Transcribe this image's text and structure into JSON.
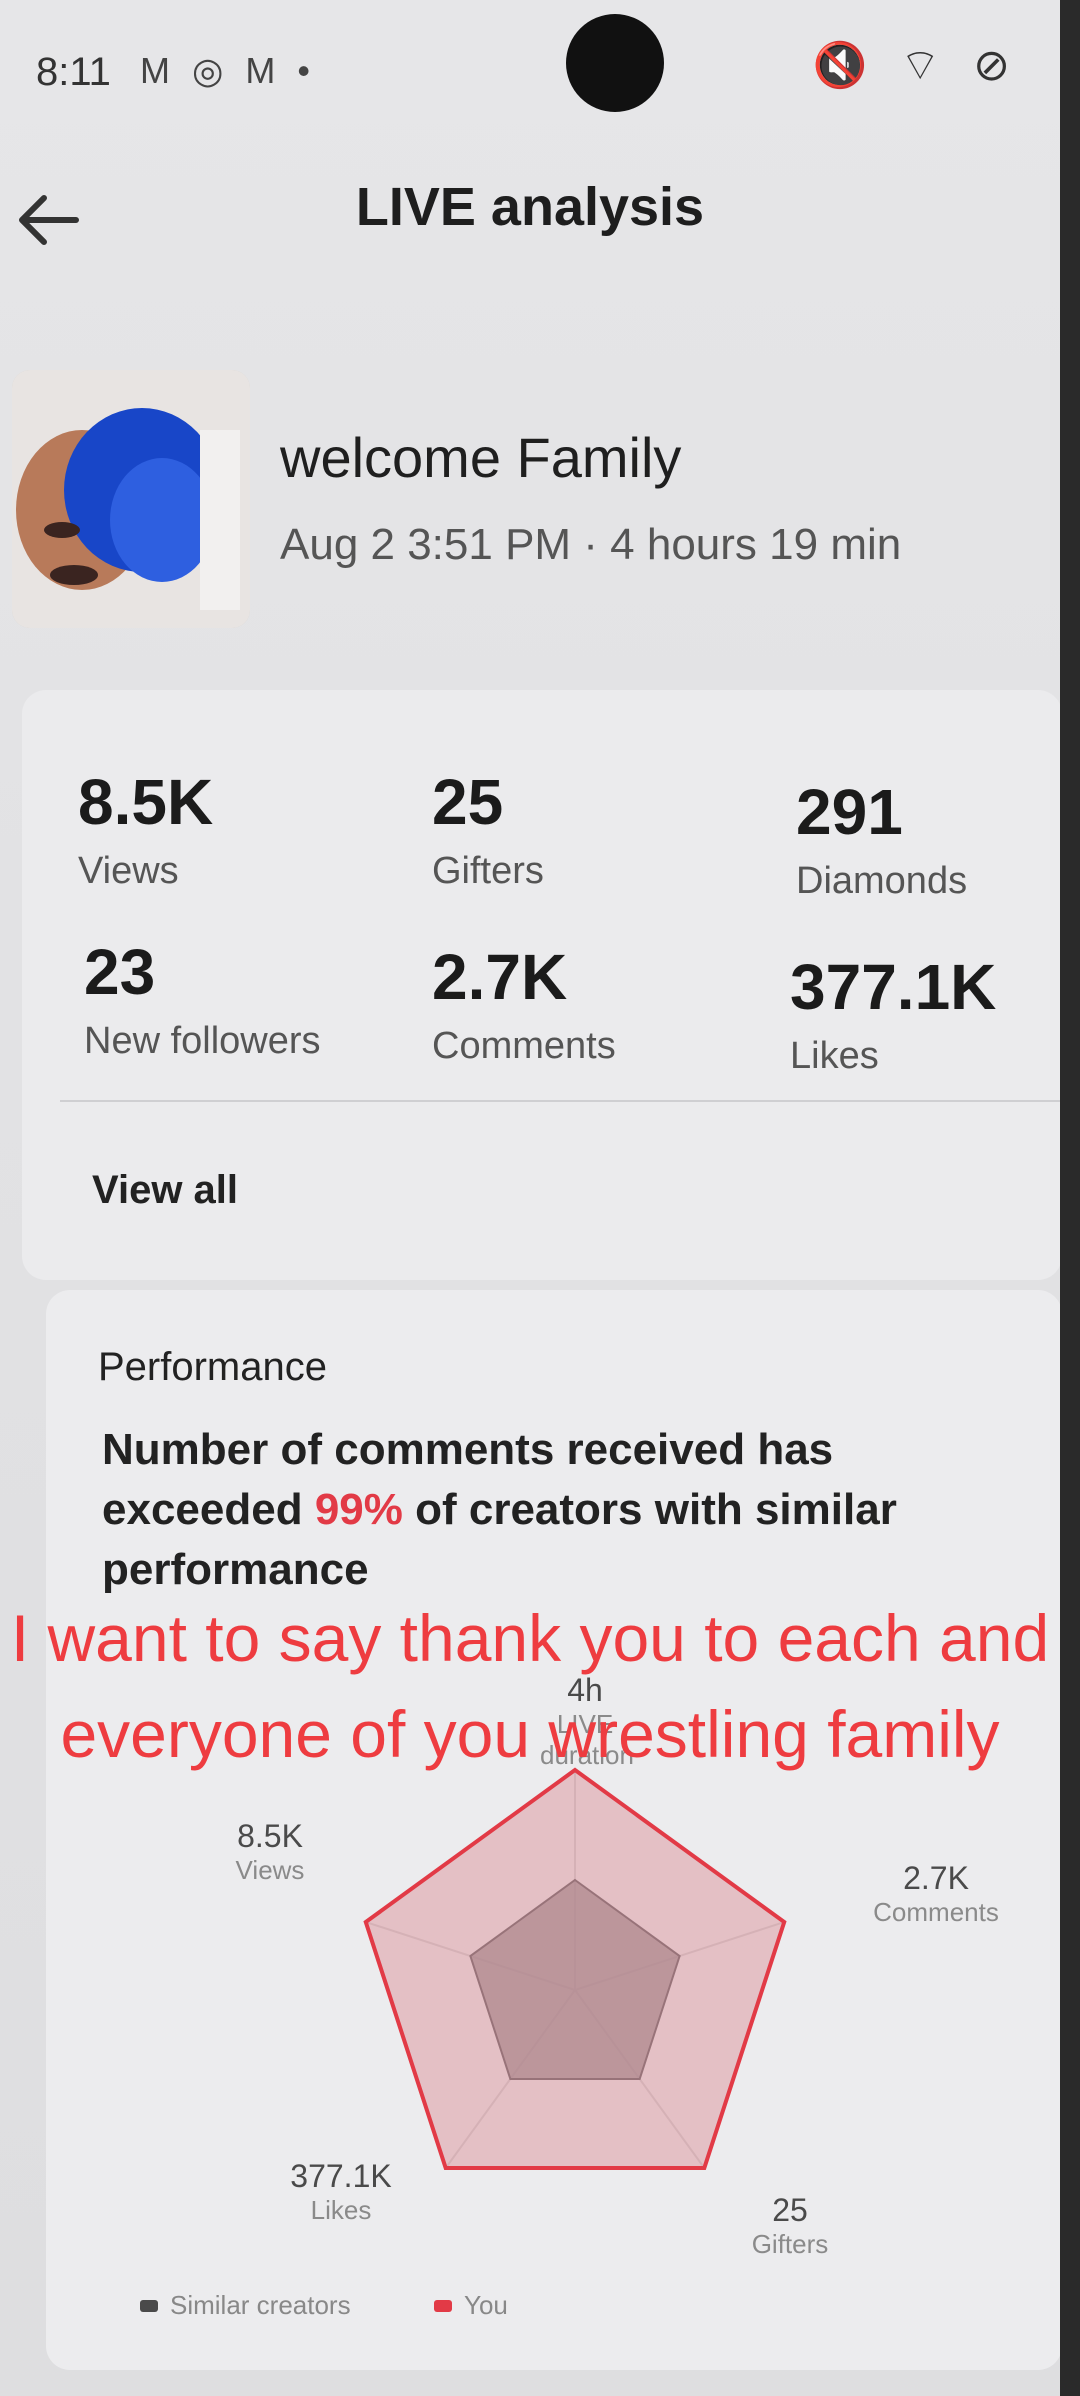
{
  "status_bar": {
    "time": "8:11",
    "notification_icons": "M ◎ M •",
    "right_icons": "🔇 ⌔ ⊘"
  },
  "header": {
    "title": "LIVE analysis"
  },
  "stream": {
    "title": "welcome Family",
    "meta": "Aug 2 3:51 PM · 4 hours 19 min"
  },
  "stats": [
    {
      "value": "8.5K",
      "label": "Views"
    },
    {
      "value": "25",
      "label": "Gifters"
    },
    {
      "value": "291",
      "label": "Diamonds"
    },
    {
      "value": "23",
      "label": "New followers"
    },
    {
      "value": "2.7K",
      "label": "Comments"
    },
    {
      "value": "377.1K",
      "label": "Likes"
    }
  ],
  "view_all_label": "View all",
  "performance": {
    "heading": "Performance",
    "text_before": "Number of comments received has exceeded ",
    "percent": "99%",
    "text_after": " of creators with similar performance"
  },
  "overlay_caption": "I want to say thank you to each and everyone of you wrestling family",
  "chart_data": {
    "type": "radar",
    "axes": [
      {
        "value": "4h",
        "label": "LIVE duration"
      },
      {
        "value": "2.7K",
        "label": "Comments"
      },
      {
        "value": "25",
        "label": "Gifters"
      },
      {
        "value": "377.1K",
        "label": "Likes"
      },
      {
        "value": "8.5K",
        "label": "Views"
      }
    ],
    "series": [
      {
        "name": "Similar creators",
        "color": "#5a5a5a",
        "values": [
          0.5,
          0.5,
          0.5,
          0.5,
          0.5
        ]
      },
      {
        "name": "You",
        "color": "#e23a46",
        "values": [
          1,
          1,
          1,
          1,
          1
        ]
      }
    ]
  },
  "colors": {
    "accent_red": "#e23a46",
    "caption_red": "#ee3c40"
  }
}
